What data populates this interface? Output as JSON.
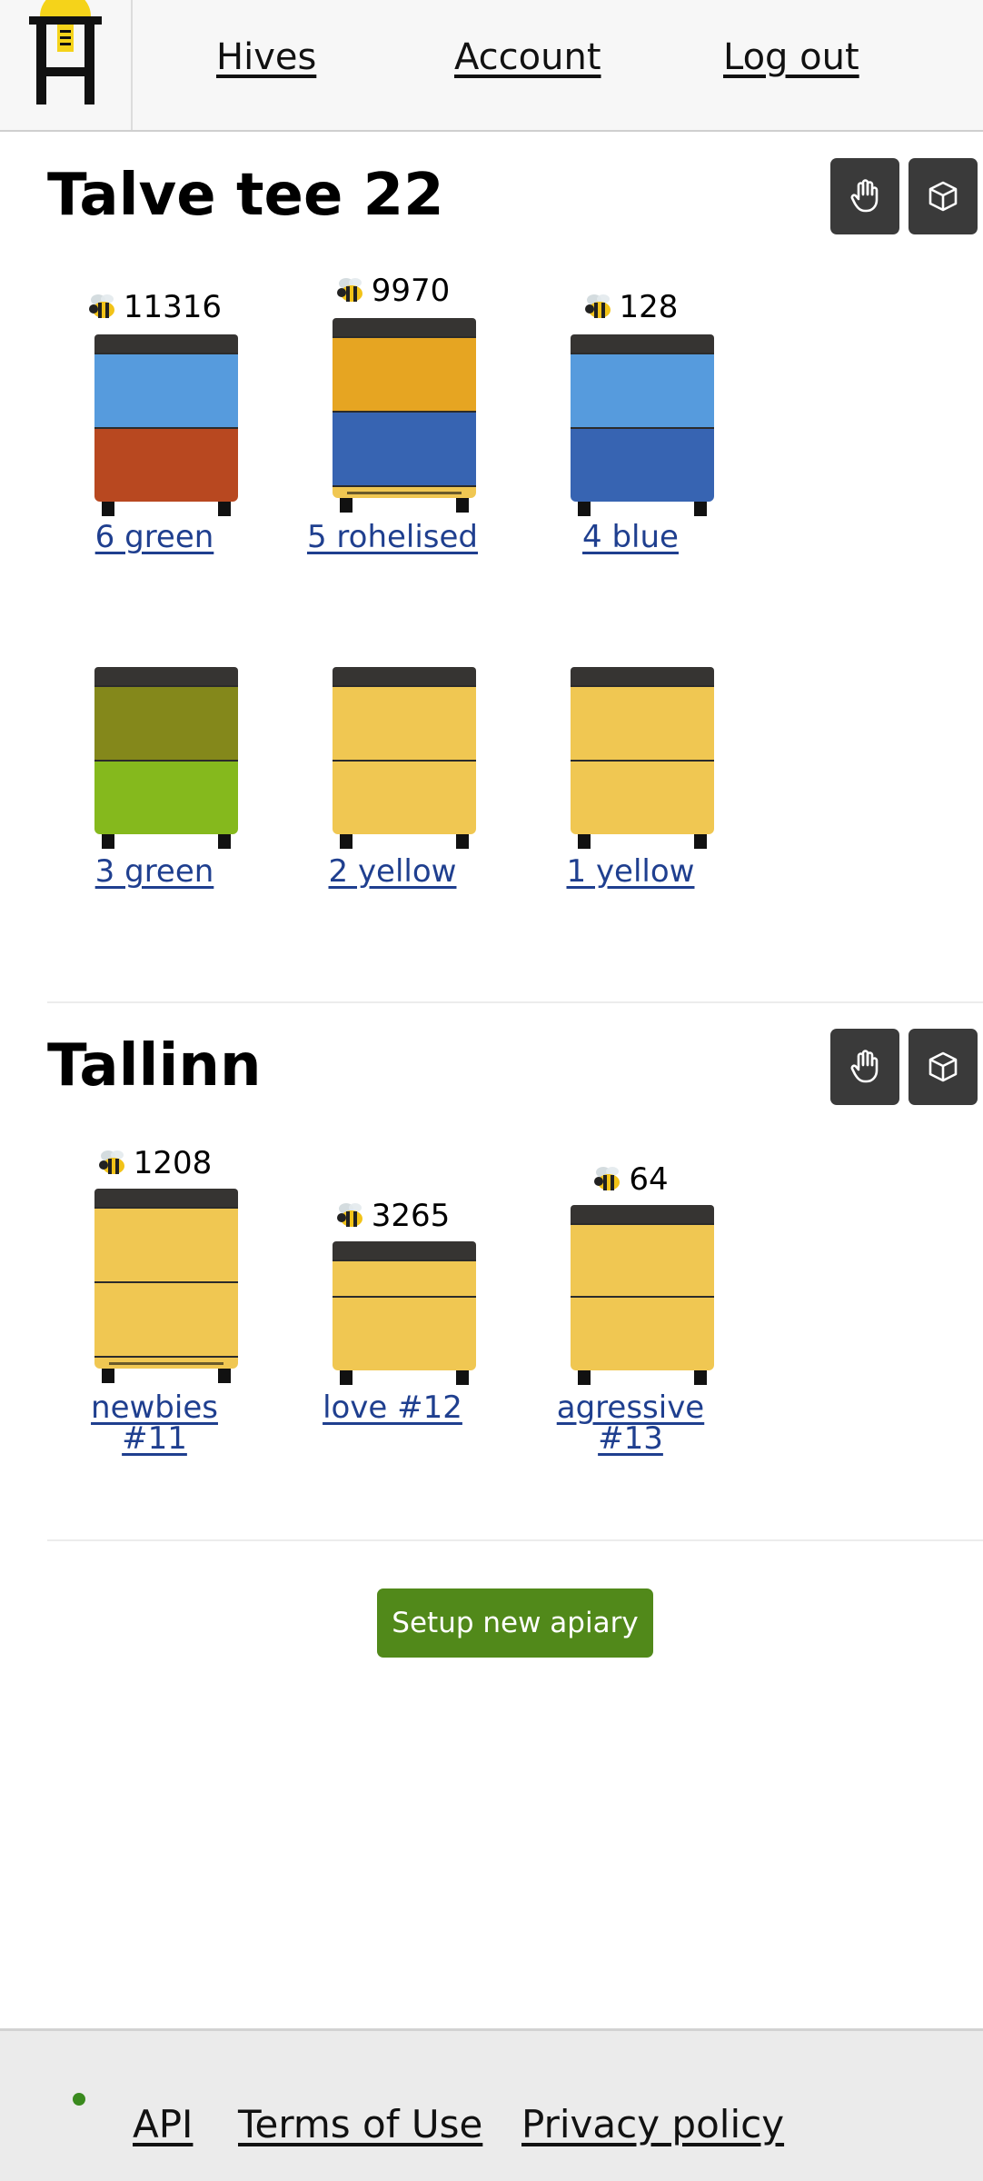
{
  "nav": {
    "hives": "Hives",
    "account": "Account",
    "logout": "Log out"
  },
  "colors": {
    "roof": "#363432",
    "green_dark": "#84881b",
    "green_light": "#85b91d",
    "yellow": "#f0c752",
    "orange": "#e6a522",
    "light_blue": "#569bdd",
    "blue": "#3764b2",
    "rust": "#b84820",
    "button_green": "#51891a",
    "link_blue": "#1f3f8f"
  },
  "apiaries": [
    {
      "name": "Talve tee 22",
      "hives": [
        {
          "label": "6 green",
          "bees": "11316",
          "boxes": [
            "light_blue",
            "rust"
          ],
          "bottom": false
        },
        {
          "label": "5 rohelised",
          "bees": "9970",
          "boxes": [
            "orange",
            "blue"
          ],
          "bottom": true
        },
        {
          "label": "4 blue",
          "bees": "128",
          "boxes": [
            "light_blue",
            "blue"
          ],
          "bottom": false
        },
        {
          "label": "3 green",
          "bees": "",
          "boxes": [
            "green_dark",
            "green_light"
          ],
          "bottom": false
        },
        {
          "label": "2 yellow",
          "bees": "",
          "boxes": [
            "yellow",
            "yellow"
          ],
          "bottom": false
        },
        {
          "label": "1 yellow",
          "bees": "",
          "boxes": [
            "yellow",
            "yellow"
          ],
          "bottom": false
        }
      ]
    },
    {
      "name": "Tallinn",
      "hives": [
        {
          "label": "newbies #11",
          "bees": "1208",
          "boxes": [
            "yellow",
            "yellow"
          ],
          "bottom": true
        },
        {
          "label": "love #12",
          "bees": "3265",
          "boxes": [
            "yellow",
            "yellow"
          ],
          "bottom": false
        },
        {
          "label": "agressive #13",
          "bees": "64",
          "boxes": [
            "yellow",
            "yellow"
          ],
          "bottom": false
        }
      ]
    }
  ],
  "setup_button": "Setup new apiary",
  "footer": {
    "api": "API",
    "terms": "Terms of Use",
    "privacy": "Privacy policy"
  },
  "icons": {
    "logo": "hive-logo-icon",
    "move": "hand-icon",
    "view3d": "cube-icon",
    "bee": "bee-icon"
  }
}
